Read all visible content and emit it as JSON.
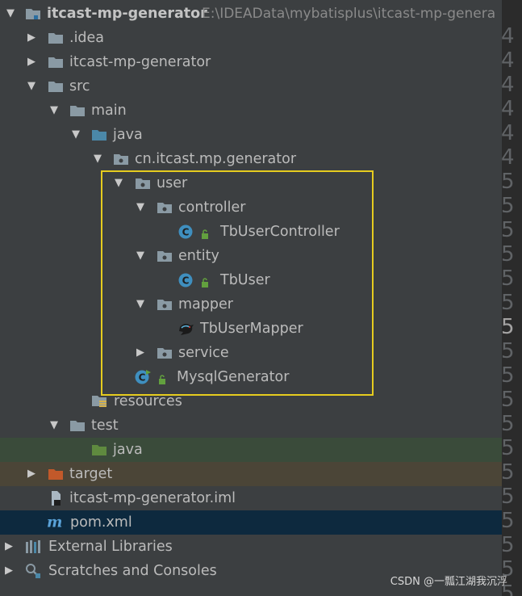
{
  "tree": {
    "root_label": "itcast-mp-generator",
    "root_path": "E:\\IDEAData\\mybatisplus\\itcast-mp-genera",
    "idea": ".idea",
    "module": "itcast-mp-generator",
    "src": "src",
    "main": "main",
    "java": "java",
    "package": "cn.itcast.mp.generator",
    "user": "user",
    "controller": "controller",
    "controller_class": "TbUserController",
    "entity": "entity",
    "entity_class": "TbUser",
    "mapper": "mapper",
    "mapper_class": "TbUserMapper",
    "service": "service",
    "generator_class": "MysqlGenerator",
    "resources": "resources",
    "test": "test",
    "test_java": "java",
    "target": "target",
    "iml": "itcast-mp-generator.iml",
    "pom": "pom.xml",
    "ext_libs": "External Libraries",
    "scratches": "Scratches and Consoles"
  },
  "gutter": [
    "4",
    "4",
    "4",
    "4",
    "4",
    "4",
    "5",
    "5",
    "5",
    "5",
    "5",
    "5",
    "5",
    "5",
    "5",
    "5",
    "5",
    "5",
    "5",
    "5",
    "5",
    "5",
    "5",
    "5"
  ],
  "watermark": "CSDN @一瓢江湖我沉浮",
  "colors": {
    "folder": "#8a9aa4",
    "source_folder": "#4b88a8",
    "test_folder": "#5f8a3f",
    "excluded_folder": "#c2592a",
    "class_icon": "#3f8fbf",
    "highlight_box": "#e6cc1f"
  }
}
